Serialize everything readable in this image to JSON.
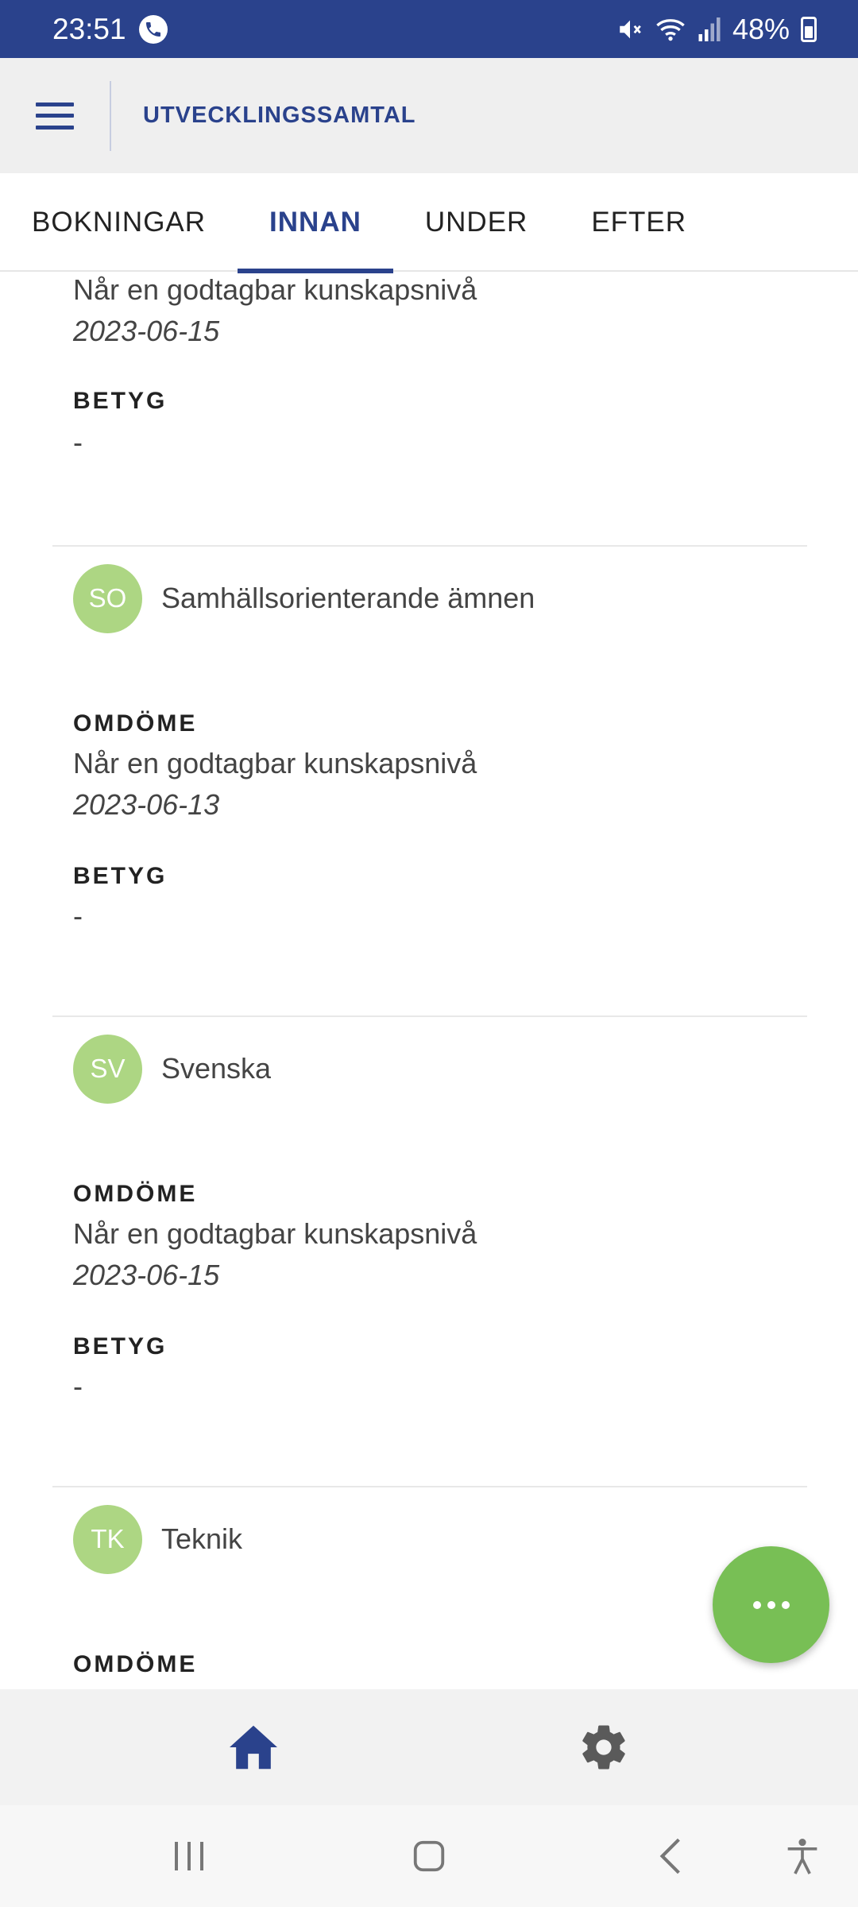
{
  "status_bar": {
    "time": "23:51",
    "battery": "48%"
  },
  "header": {
    "title": "UTVECKLINGSSAMTAL"
  },
  "tabs": [
    {
      "label": "BOKNINGAR",
      "active": false
    },
    {
      "label": "INNAN",
      "active": true
    },
    {
      "label": "UNDER",
      "active": false
    },
    {
      "label": "EFTER",
      "active": false
    }
  ],
  "cards": {
    "partial": {
      "omdome_value": "Når en godtagbar kunskapsnivå",
      "omdome_date": "2023-06-15",
      "betyg_label": "BETYG",
      "betyg_value": "-"
    },
    "so": {
      "initials": "SO",
      "name": "Samhällsorienterande ämnen",
      "omdome_label": "OMDÖME",
      "omdome_value": "Når en godtagbar kunskapsnivå",
      "omdome_date": "2023-06-13",
      "betyg_label": "BETYG",
      "betyg_value": "-"
    },
    "sv": {
      "initials": "SV",
      "name": "Svenska",
      "omdome_label": "OMDÖME",
      "omdome_value": "Når en godtagbar kunskapsnivå",
      "omdome_date": "2023-06-15",
      "betyg_label": "BETYG",
      "betyg_value": "-"
    },
    "tk": {
      "initials": "TK",
      "name": "Teknik",
      "omdome_label": "OMDÖME"
    }
  },
  "colors": {
    "primary": "#2a428c",
    "avatar": "#add683",
    "fab": "#78bf55"
  },
  "icons": {
    "fab": "more-horizontal-icon",
    "nav_home": "home-icon",
    "nav_settings": "gear-icon"
  }
}
